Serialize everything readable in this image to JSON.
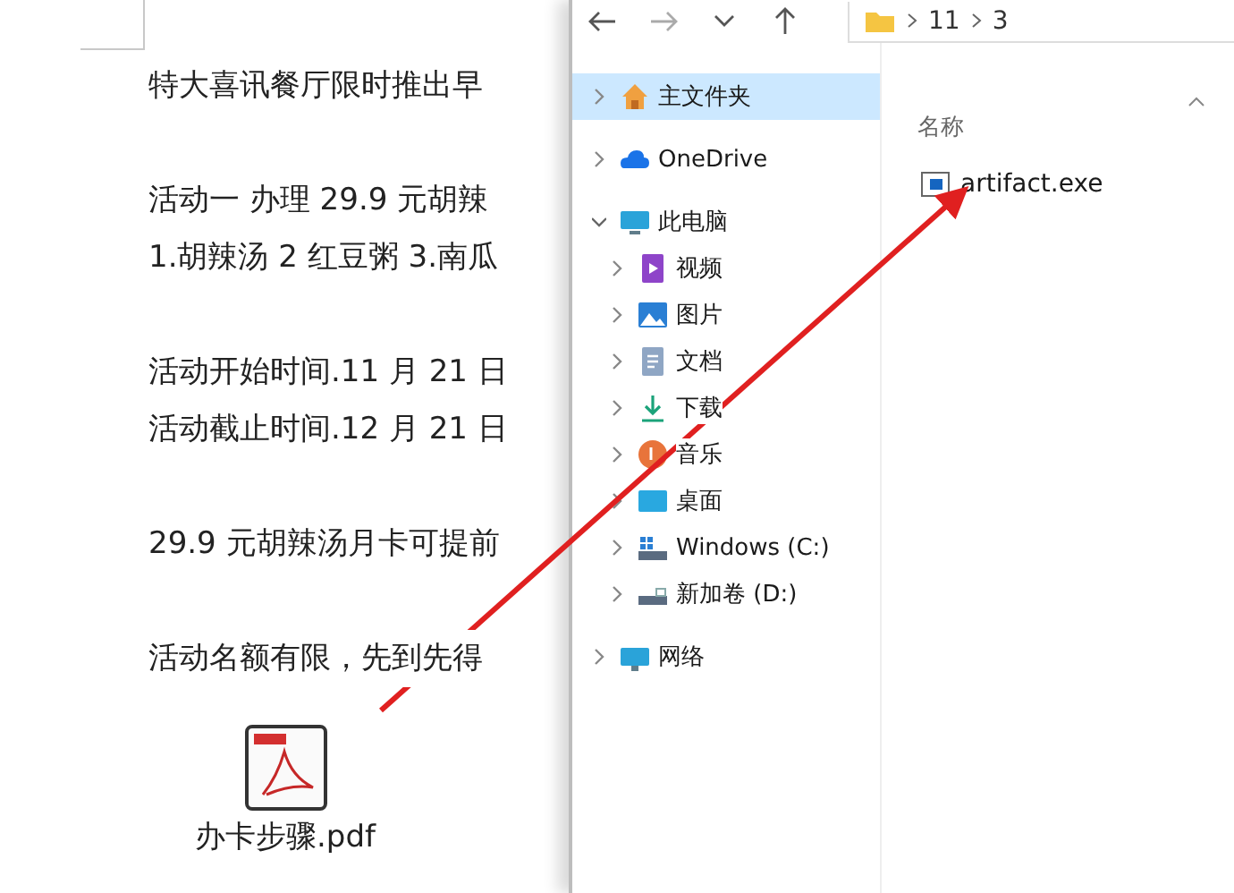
{
  "document": {
    "paragraphs": [
      [
        "特大喜讯餐厅限时推出早"
      ],
      [
        "活动一  办理 29.9 元胡辣",
        "1.胡辣汤  2 红豆粥 3.南瓜"
      ],
      [
        "活动开始时间.11 月 21 日",
        "活动截止时间.12 月 21 日"
      ],
      [
        "29.9 元胡辣汤月卡可提前"
      ],
      [
        "活动名额有限，先到先得"
      ]
    ],
    "attachment": {
      "name": "办卡步骤.pdf"
    }
  },
  "explorer": {
    "breadcrumb": [
      "11",
      "3"
    ],
    "nav": [
      {
        "label": "主文件夹",
        "kind": "home",
        "expanded": false,
        "selected": true
      },
      {
        "label": "OneDrive",
        "kind": "cloud",
        "expanded": false,
        "selected": false
      },
      {
        "label": "此电脑",
        "kind": "pc",
        "expanded": true,
        "selected": false,
        "children": [
          {
            "label": "视频",
            "kind": "video",
            "expanded": false,
            "selected": false
          },
          {
            "label": "图片",
            "kind": "pictures",
            "expanded": false,
            "selected": false
          },
          {
            "label": "文档",
            "kind": "documents",
            "expanded": false,
            "selected": false
          },
          {
            "label": "下载",
            "kind": "downloads",
            "expanded": false,
            "selected": false
          },
          {
            "label": "音乐",
            "kind": "music",
            "expanded": false,
            "selected": false
          },
          {
            "label": "桌面",
            "kind": "desktop",
            "expanded": false,
            "selected": false
          },
          {
            "label": "Windows (C:)",
            "kind": "system-drive",
            "expanded": false,
            "selected": false
          },
          {
            "label": "新加卷 (D:)",
            "kind": "drive",
            "expanded": false,
            "selected": false
          }
        ]
      },
      {
        "label": "网络",
        "kind": "network",
        "expanded": false,
        "selected": false
      }
    ],
    "column_header": "名称",
    "files": [
      {
        "name": "artifact.exe",
        "selected": false
      }
    ]
  }
}
